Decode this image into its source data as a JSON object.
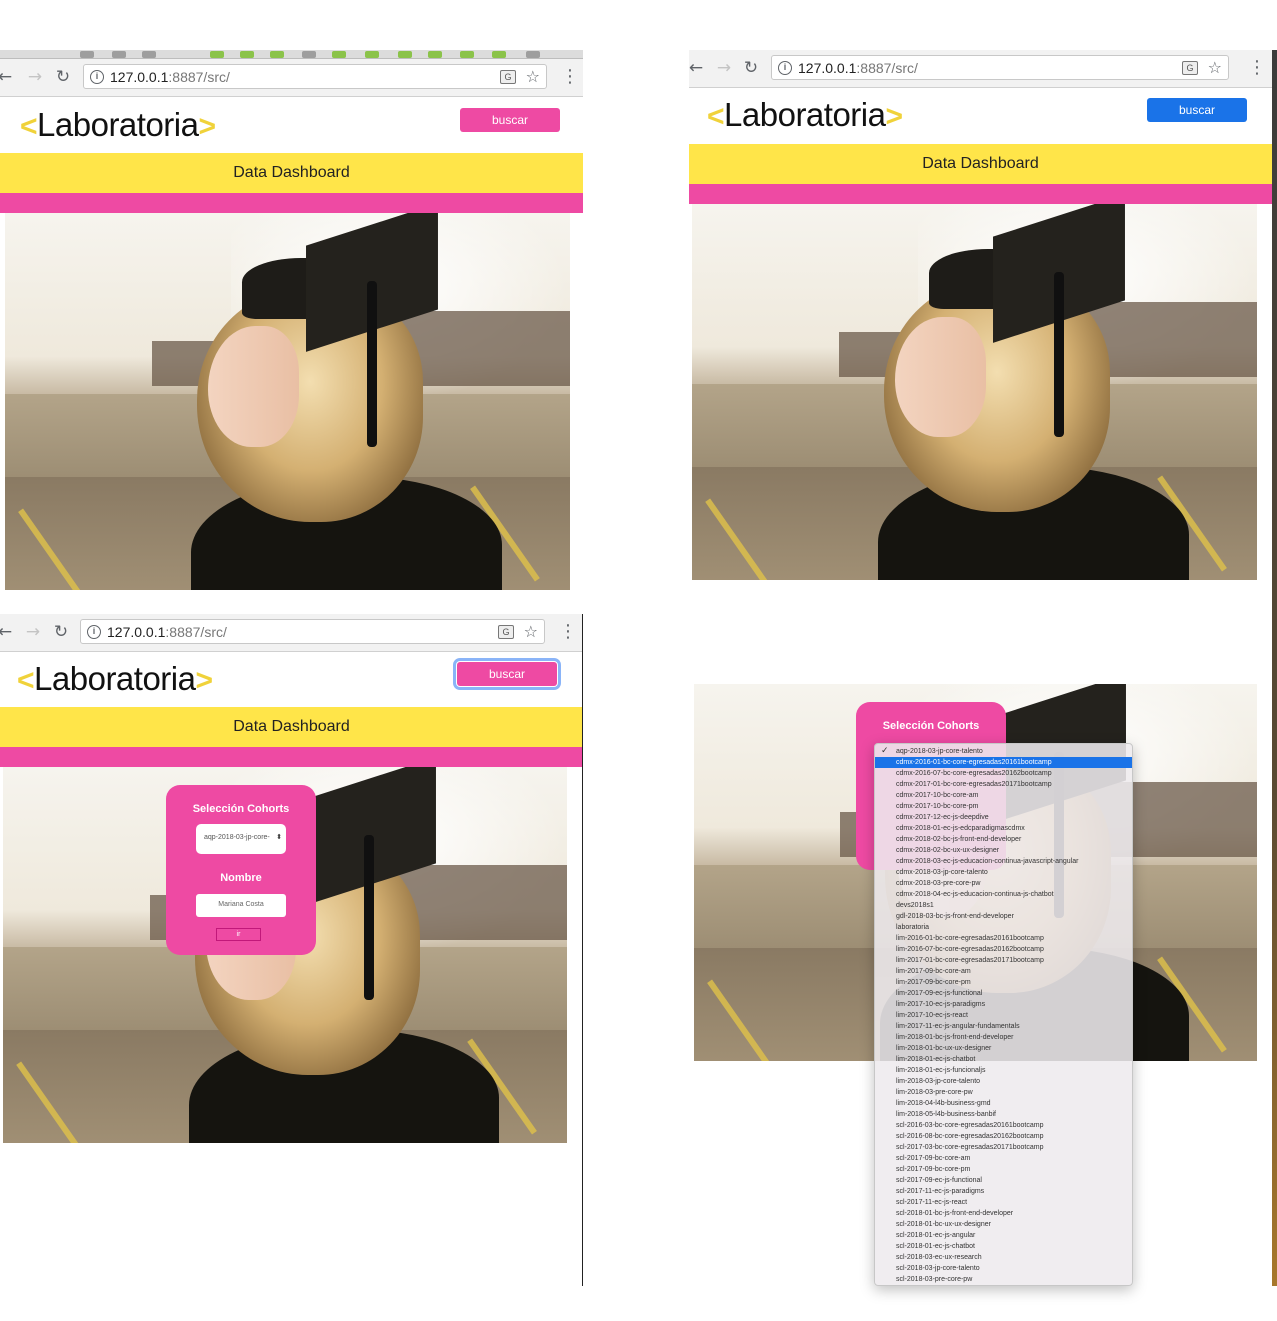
{
  "browser": {
    "url_host": "127.0.0.1",
    "url_rest": ":8887/src/",
    "back_icon": "←",
    "forward_icon": "→",
    "reload_icon": "↻",
    "info_icon": "i",
    "translate_icon": "G",
    "star_icon": "☆",
    "menu_icon": "⋮"
  },
  "header": {
    "logo_left": "<",
    "logo_text": "Laboratoria",
    "logo_right": ">",
    "search_button": "buscar",
    "band_title": "Data Dashboard"
  },
  "colors": {
    "brand_pink": "#ee4aa3",
    "brand_yellow": "#ffe549",
    "button_blue": "#1a73e8"
  },
  "form": {
    "title": "Selección Cohorts",
    "selected_cohort": "aqp-2018-03-jp-core-",
    "select_arrows": "⬍",
    "name_label": "Nombre",
    "name_value": "Mariana Costa",
    "submit_label": "ir"
  },
  "dropdown": {
    "title": "Selección Cohorts",
    "checkmark": "✓",
    "checked_index": 0,
    "highlighted_index": 1,
    "options": [
      "aqp-2018-03-jp-core-talento",
      "cdmx-2016-01-bc-core-egresadas20161bootcamp",
      "cdmx-2016-07-bc-core-egresadas20162bootcamp",
      "cdmx-2017-01-bc-core-egresadas20171bootcamp",
      "cdmx-2017-10-bc-core-am",
      "cdmx-2017-10-bc-core-pm",
      "cdmx-2017-12-ec-js-deepdive",
      "cdmx-2018-01-ec-js-edcparadigmascdmx",
      "cdmx-2018-02-bc-js-front-end-developer",
      "cdmx-2018-02-bc-ux-ux-designer",
      "cdmx-2018-03-ec-js-educacion-continua-javascript-angular",
      "cdmx-2018-03-jp-core-talento",
      "cdmx-2018-03-pre-core-pw",
      "cdmx-2018-04-ec-js-educacion-continua-js-chatbot",
      "devs2018s1",
      "gdl-2018-03-bc-js-front-end-developer",
      "laboratoria",
      "lim-2016-01-bc-core-egresadas20161bootcamp",
      "lim-2016-07-bc-core-egresadas20162bootcamp",
      "lim-2017-01-bc-core-egresadas20171bootcamp",
      "lim-2017-09-bc-core-am",
      "lim-2017-09-bc-core-pm",
      "lim-2017-09-ec-js-functional",
      "lim-2017-10-ec-js-paradigms",
      "lim-2017-10-ec-js-react",
      "lim-2017-11-ec-js-angular-fundamentals",
      "lim-2018-01-bc-js-front-end-developer",
      "lim-2018-01-bc-ux-ux-designer",
      "lim-2018-01-ec-js-chatbot",
      "lim-2018-01-ec-js-funcionaljs",
      "lim-2018-03-jp-core-talento",
      "lim-2018-03-pre-core-pw",
      "lim-2018-04-l4b-business-gmd",
      "lim-2018-05-l4b-business-banbif",
      "scl-2016-03-bc-core-egresadas20161bootcamp",
      "scl-2016-08-bc-core-egresadas20162bootcamp",
      "scl-2017-03-bc-core-egresadas20171bootcamp",
      "scl-2017-09-bc-core-am",
      "scl-2017-09-bc-core-pm",
      "scl-2017-09-ec-js-functional",
      "scl-2017-11-ec-js-paradigms",
      "scl-2017-11-ec-js-react",
      "scl-2018-01-bc-js-front-end-developer",
      "scl-2018-01-bc-ux-ux-designer",
      "scl-2018-01-ec-js-angular",
      "scl-2018-01-ec-js-chatbot",
      "scl-2018-03-ec-ux-research",
      "scl-2018-03-jp-core-talento",
      "scl-2018-03-pre-core-pw"
    ]
  }
}
